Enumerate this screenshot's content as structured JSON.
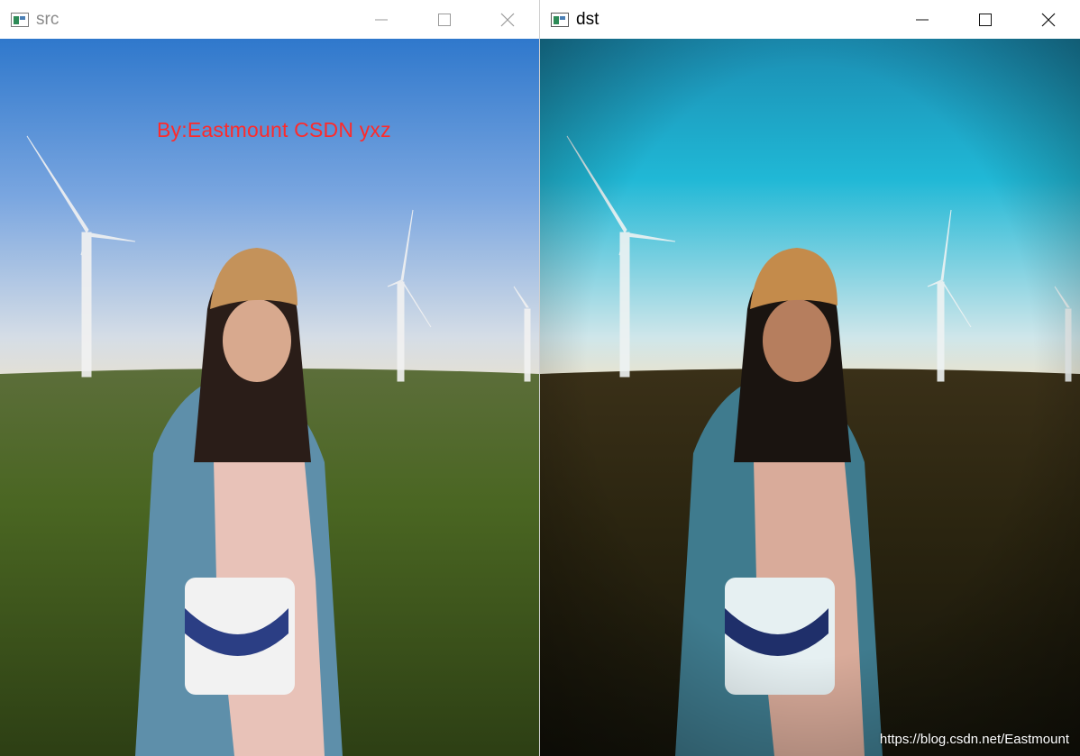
{
  "windows": {
    "src": {
      "title": "src",
      "overlay_text": "By:Eastmount CSDN yxz"
    },
    "dst": {
      "title": "dst",
      "watermark": "https://blog.csdn.net/Eastmount"
    }
  },
  "controls": {
    "minimize_icon": "minimize-icon",
    "maximize_icon": "maximize-icon",
    "close_icon": "close-icon"
  },
  "colors": {
    "src_sky_top": "#3a7fd0",
    "src_sky_bottom": "#d9e4ee",
    "src_grass": "#3f5a1c",
    "dst_sky_top": "#1a8fb0",
    "dst_sky_bottom": "#cde6ea",
    "dst_grass": "#2a2410",
    "overlay_text": "#ff2a2a"
  }
}
